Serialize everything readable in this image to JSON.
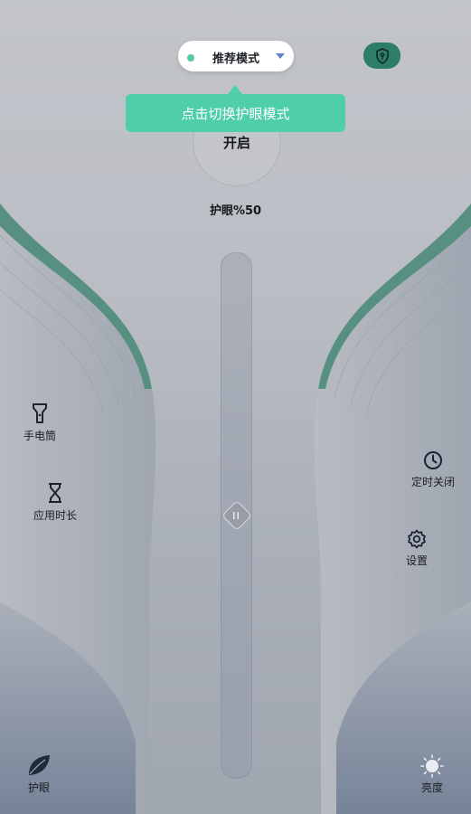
{
  "mode_selector": {
    "label": "推荐模式",
    "dot_color": "#4ecba7"
  },
  "tooltip": {
    "text": "点击切换护眼模式"
  },
  "power": {
    "label": "开启"
  },
  "eye_protection": {
    "percent_text": "护眼%50",
    "level_percent": 50
  },
  "left_actions": [
    {
      "label": "手电筒",
      "icon": "flashlight-icon"
    },
    {
      "label": "应用时长",
      "icon": "hourglass-icon"
    }
  ],
  "right_actions": [
    {
      "label": "定时关闭",
      "icon": "clock-icon"
    },
    {
      "label": "设置",
      "icon": "gear-icon"
    }
  ],
  "bottom_nav": {
    "left": {
      "label": "护眼",
      "icon": "leaf-icon"
    },
    "right": {
      "label": "亮度",
      "icon": "sun-icon"
    }
  },
  "colors": {
    "accent": "#4fcfa9",
    "shield_bg": "#2e7d67",
    "wave_green": "#3a9a79"
  }
}
